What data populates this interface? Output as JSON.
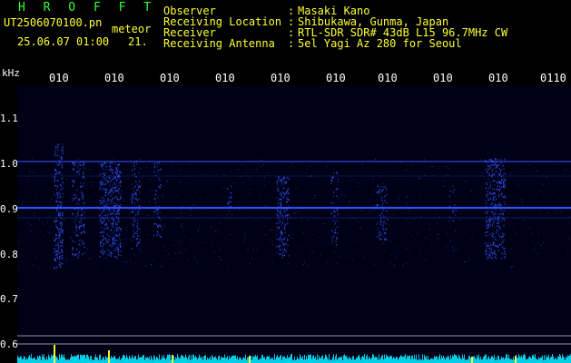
{
  "header": {
    "title": "H R O F F T",
    "file_name": "UT2506070100.pn",
    "mode": "meteor",
    "datetime": "25.06.07 01:00",
    "count": "21."
  },
  "info": [
    {
      "key": "Observer",
      "sep": ":",
      "value": "Masaki Kano"
    },
    {
      "key": "Receiving Location",
      "sep": ":",
      "value": "Shibukawa, Gunma, Japan"
    },
    {
      "key": "Receiver",
      "sep": ":",
      "value": "RTL-SDR SDR# 43dB L15 96.7MHz CW"
    },
    {
      "key": "Receiving Antenna",
      "sep": ":",
      "value": "5el Yagi Az 280 for Seoul"
    }
  ],
  "axis": {
    "unit": "kHz",
    "y_ticks": [
      "1.1",
      "1.0",
      "0.9",
      "0.8",
      "0.7",
      "0.6"
    ],
    "x_ticks": [
      "010",
      "010",
      "010",
      "010",
      "010",
      "010",
      "010",
      "010",
      "010",
      "0110"
    ]
  },
  "colors": {
    "header_yellow": "#ffff33",
    "title_green": "#33ff33",
    "signal_blue": "#3355ff",
    "noise_cyan": "#00e5ff"
  }
}
